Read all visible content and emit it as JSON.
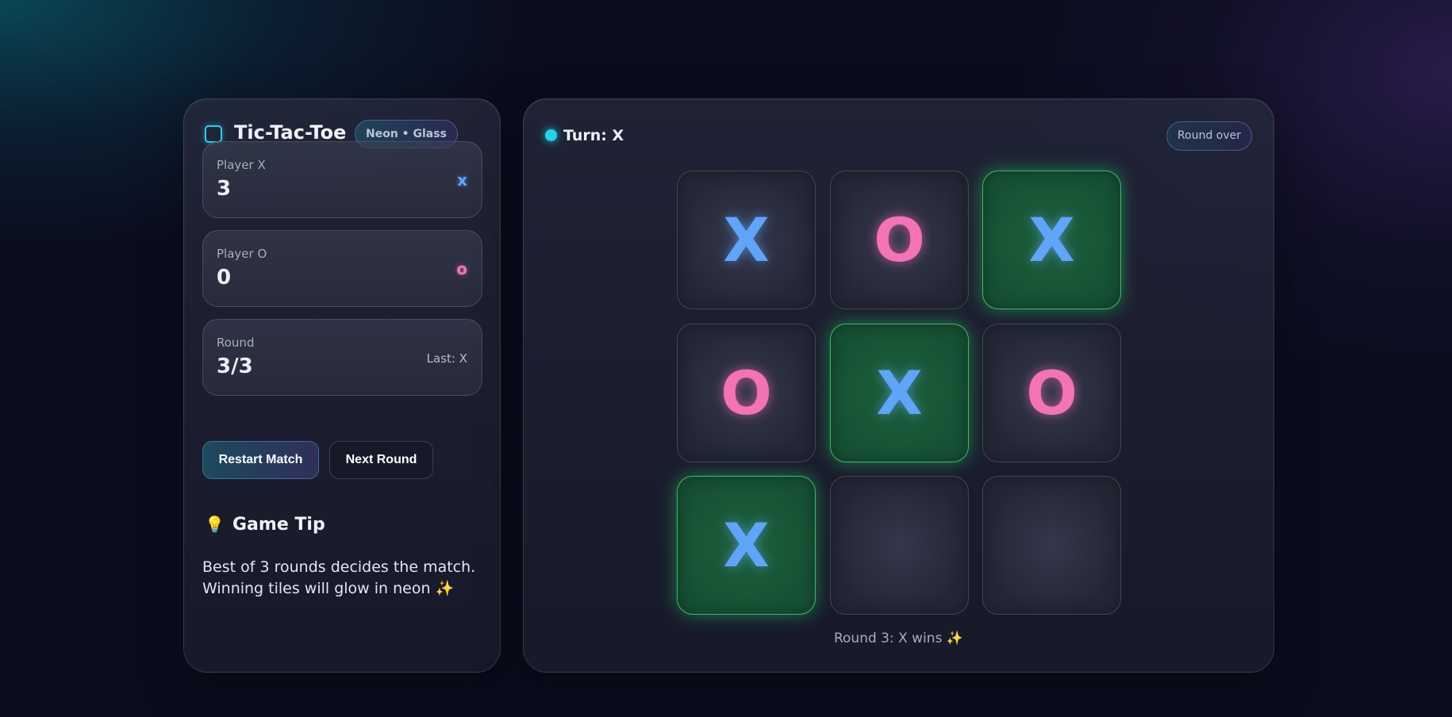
{
  "app": {
    "title": "Tic-Tac-Toe",
    "tag": "Neon • Glass"
  },
  "scores": {
    "player_x": {
      "label": "Player X",
      "value": "3",
      "mark": "x"
    },
    "player_o": {
      "label": "Player O",
      "value": "0",
      "mark": "o"
    },
    "round": {
      "label": "Round",
      "value": "3/3",
      "last": "Last: X"
    }
  },
  "buttons": {
    "restart": "Restart Match",
    "next_round": "Next Round"
  },
  "tip": {
    "icon": "💡",
    "title": "Game Tip",
    "text": "Best of 3 rounds decides the match. Winning tiles will glow in neon ✨"
  },
  "turn": {
    "text": "Turn: X"
  },
  "status": "Round over",
  "board": {
    "cells": [
      "X",
      "O",
      "X",
      "O",
      "X",
      "O",
      "X",
      "",
      ""
    ],
    "winning_cells": [
      2,
      4,
      6
    ]
  },
  "round_message": "Round 3: X wins ✨",
  "colors": {
    "x": "#60a5fa",
    "o": "#f472b6",
    "win": "#22c55e",
    "accent": "#22d3ee"
  }
}
